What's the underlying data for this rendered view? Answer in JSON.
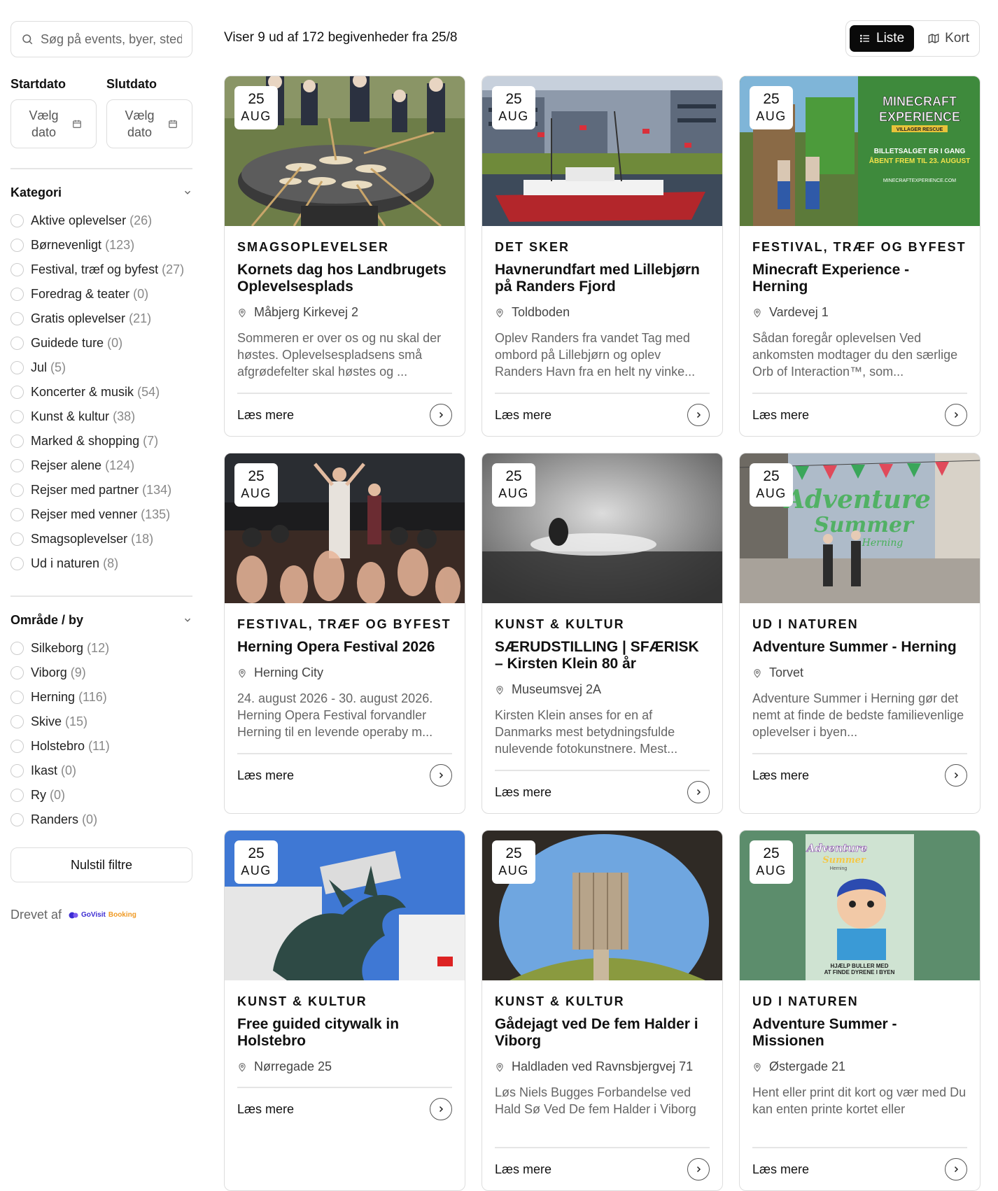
{
  "search": {
    "placeholder": "Søg på events, byer, steder"
  },
  "dates": {
    "start_label": "Startdato",
    "end_label": "Slutdato",
    "start_value": "Vælg dato",
    "end_value": "Vælg dato"
  },
  "categories": {
    "title": "Kategori",
    "items": [
      {
        "label": "Aktive oplevelser",
        "count": "(26)"
      },
      {
        "label": "Børnevenligt",
        "count": "(123)"
      },
      {
        "label": "Festival, træf og byfest",
        "count": "(27)"
      },
      {
        "label": "Foredrag & teater",
        "count": "(0)"
      },
      {
        "label": "Gratis oplevelser",
        "count": "(21)"
      },
      {
        "label": "Guidede ture",
        "count": "(0)"
      },
      {
        "label": "Jul",
        "count": "(5)"
      },
      {
        "label": "Koncerter & musik",
        "count": "(54)"
      },
      {
        "label": "Kunst & kultur",
        "count": "(38)"
      },
      {
        "label": "Marked & shopping",
        "count": "(7)"
      },
      {
        "label": "Rejser alene",
        "count": "(124)"
      },
      {
        "label": "Rejser med partner",
        "count": "(134)"
      },
      {
        "label": "Rejser med venner",
        "count": "(135)"
      },
      {
        "label": "Smagsoplevelser",
        "count": "(18)"
      },
      {
        "label": "Ud i naturen",
        "count": "(8)"
      }
    ]
  },
  "areas": {
    "title": "Område / by",
    "items": [
      {
        "label": "Silkeborg",
        "count": "(12)"
      },
      {
        "label": "Viborg",
        "count": "(9)"
      },
      {
        "label": "Herning",
        "count": "(116)"
      },
      {
        "label": "Skive",
        "count": "(15)"
      },
      {
        "label": "Holstebro",
        "count": "(11)"
      },
      {
        "label": "Ikast",
        "count": "(0)"
      },
      {
        "label": "Ry",
        "count": "(0)"
      },
      {
        "label": "Randers",
        "count": "(0)"
      }
    ]
  },
  "reset_label": "Nulstil filtre",
  "powered": {
    "label": "Drevet af",
    "logo_part1": "GoVisit",
    "logo_part2": "Booking"
  },
  "result_text": "Viser 9 ud af 172 begivenheder fra 25/8",
  "view_toggle": {
    "list_label": "Liste",
    "map_label": "Kort",
    "active": "Liste"
  },
  "read_more_label": "Læs mere",
  "colors": {
    "accent": "#0a0a0a",
    "border": "#dddddd",
    "muted": "#666666"
  },
  "events": [
    {
      "day": "25",
      "month": "AUG",
      "category": "SMAGSOPLEVELSER",
      "title": "Kornets dag hos Landbrugets Oplevelsesplads",
      "location": "Måbjerg Kirkevej 2",
      "description": "Sommeren er over os og nu skal der høstes. Oplevelsespladsens små afgrødefelter skal høstes og ..."
    },
    {
      "day": "25",
      "month": "AUG",
      "category": "DET SKER",
      "title": "Havnerundfart med Lillebjørn på Randers Fjord",
      "location": "Toldboden",
      "description": "Oplev Randers fra vandet Tag med ombord på Lillebjørn og oplev Randers Havn fra en helt ny vinke..."
    },
    {
      "day": "25",
      "month": "AUG",
      "category": "FESTIVAL, TRÆF OG BYFEST",
      "title": "Minecraft Experience - Herning",
      "location": "Vardevej 1",
      "description": "Sådan foregår oplevelsen Ved ankomsten modtager du den særlige Orb of Interaction™, som..."
    },
    {
      "day": "25",
      "month": "AUG",
      "category": "FESTIVAL, TRÆF OG BYFEST",
      "title": "Herning Opera Festival 2026",
      "location": "Herning City",
      "description": "24. august 2026 - 30. august 2026. Herning Opera Festival forvandler Herning til en levende operaby m..."
    },
    {
      "day": "25",
      "month": "AUG",
      "category": "KUNST & KULTUR",
      "title": "SÆRUDSTILLING | SFÆRISK – Kirsten Klein 80 år",
      "location": "Museumsvej 2A",
      "description": "Kirsten Klein anses for en af Danmarks mest betydningsfulde nulevende fotokunstnere. Mest..."
    },
    {
      "day": "25",
      "month": "AUG",
      "category": "UD I NATUREN",
      "title": "Adventure Summer - Herning",
      "location": "Torvet",
      "description": "Adventure Summer i Herning gør det nemt at finde de bedste familievenlige oplevelser i byen..."
    },
    {
      "day": "25",
      "month": "AUG",
      "category": "KUNST & KULTUR",
      "title": "Free guided citywalk in Holstebro",
      "location": "Nørregade 25",
      "description": ""
    },
    {
      "day": "25",
      "month": "AUG",
      "category": "KUNST & KULTUR",
      "title": "Gådejagt ved De fem Halder i Viborg",
      "location": "Haldladen ved Ravnsbjergvej 71",
      "description": "Løs Niels Bugges Forbandelse ved Hald Sø Ved De fem Halder i Viborg"
    },
    {
      "day": "25",
      "month": "AUG",
      "category": "UD I NATUREN",
      "title": "Adventure Summer - Missionen",
      "location": "Østergade 21",
      "description": "Hent eller print dit kort og vær med Du kan enten printe kortet eller"
    },
    {
      "day": "",
      "month": "",
      "category": "",
      "title": "",
      "location": "",
      "description": ""
    }
  ],
  "image_texts": {
    "minecraft_title": "MINECRAFT EXPERIENCE",
    "minecraft_sub": "VILLAGER RESCUE",
    "minecraft_line1": "BILLETSALGET ER I GANG",
    "minecraft_line2": "ÅBENT FREM TIL 23. AUGUST",
    "minecraft_url": "MINECRAFTEXPERIENCE.COM",
    "adventure_logo": "Adventure Summer",
    "adventure_city": "Herning",
    "poster_line1": "HJÆLP BULLER MED",
    "poster_line2": "AT FINDE DYRENE I BYEN"
  }
}
